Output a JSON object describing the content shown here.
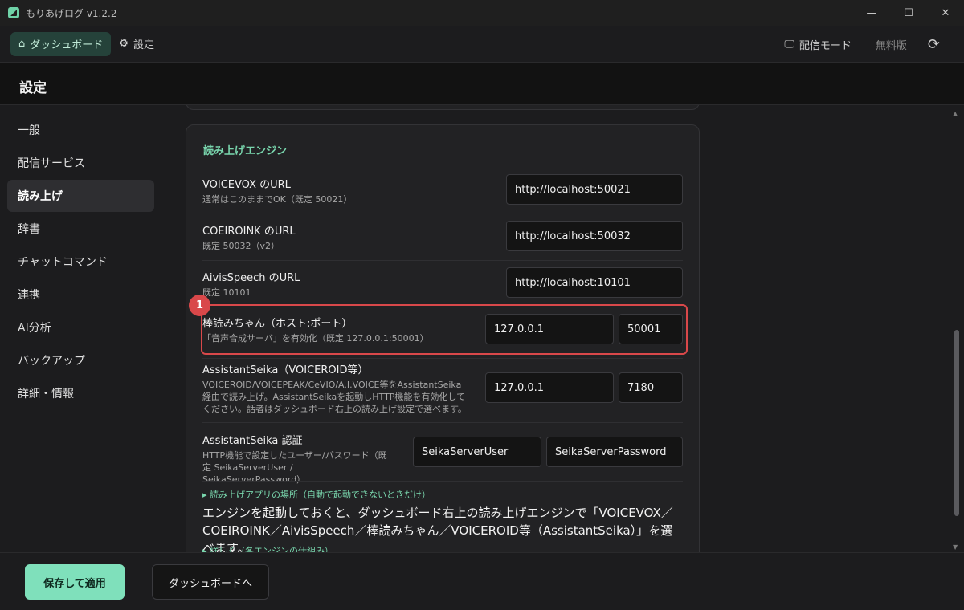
{
  "window": {
    "title": "もりあげログ  v1.2.2",
    "minimize_glyph": "—",
    "maximize_glyph": "☐",
    "close_glyph": "✕"
  },
  "topnav": {
    "dashboard": "ダッシュボード",
    "settings": "設定",
    "broadcast_mode": "配信モード",
    "free_edition": "無料版"
  },
  "page": {
    "title": "設定"
  },
  "sidebar": {
    "items": [
      {
        "label": "一般"
      },
      {
        "label": "配信サービス"
      },
      {
        "label": "読み上げ"
      },
      {
        "label": "辞書"
      },
      {
        "label": "チャットコマンド"
      },
      {
        "label": "連携"
      },
      {
        "label": "AI分析"
      },
      {
        "label": "バックアップ"
      },
      {
        "label": "詳細・情報"
      }
    ],
    "active_index": 2
  },
  "engine": {
    "section_title": "読み上げエンジン",
    "voicevox": {
      "label": "VOICEVOX のURL",
      "desc": "通常はこのままでOK（既定 50021）",
      "value": "http://localhost:50021"
    },
    "coeiroink": {
      "label": "COEIROINK のURL",
      "desc": "既定 50032（v2）",
      "value": "http://localhost:50032"
    },
    "aivis": {
      "label": "AivisSpeech のURL",
      "desc": "既定 10101",
      "value": "http://localhost:10101"
    },
    "bouyomi": {
      "badge": "1",
      "label": "棒読みちゃん（ホスト:ポート）",
      "desc": "「音声合成サーバ」を有効化（既定 127.0.0.1:50001）",
      "host": "127.0.0.1",
      "port": "50001"
    },
    "seika": {
      "label": "AssistantSeika（VOICEROID等）",
      "desc": "VOICEROID/VOICEPEAK/CeVIO/A.I.VOICE等をAssistantSeika経由で読み上げ。AssistantSeikaを起動しHTTP機能を有効化してください。話者はダッシュボード右上の読み上げ設定で選べます。",
      "host": "127.0.0.1",
      "port": "7180"
    },
    "seika_auth": {
      "label": "AssistantSeika 認証",
      "desc": "HTTP機能で設定したユーザー/パスワード（既定 SeikaServerUser / SeikaServerPassword）",
      "user": "SeikaServerUser",
      "password": "SeikaServerPassword"
    },
    "app_location_link": "▸ 読み上げアプリの場所（自動で起動できないときだけ）",
    "notice": "エンジンを起動しておくと、ダッシュボード右上の読み上げエンジンで「VOICEVOX／COEIROINK／AivisSpeech／棒読みちゃん／VOICEROID等（AssistantSeika）」を選べます。",
    "details_link": "▸ 詳しく（各エンジンの仕組み）"
  },
  "footer": {
    "save": "保存して適用",
    "to_dashboard": "ダッシュボードへ"
  },
  "colors": {
    "accent": "#79d6ad",
    "primary_button": "#7fe0bb",
    "highlight": "#d9484a"
  }
}
